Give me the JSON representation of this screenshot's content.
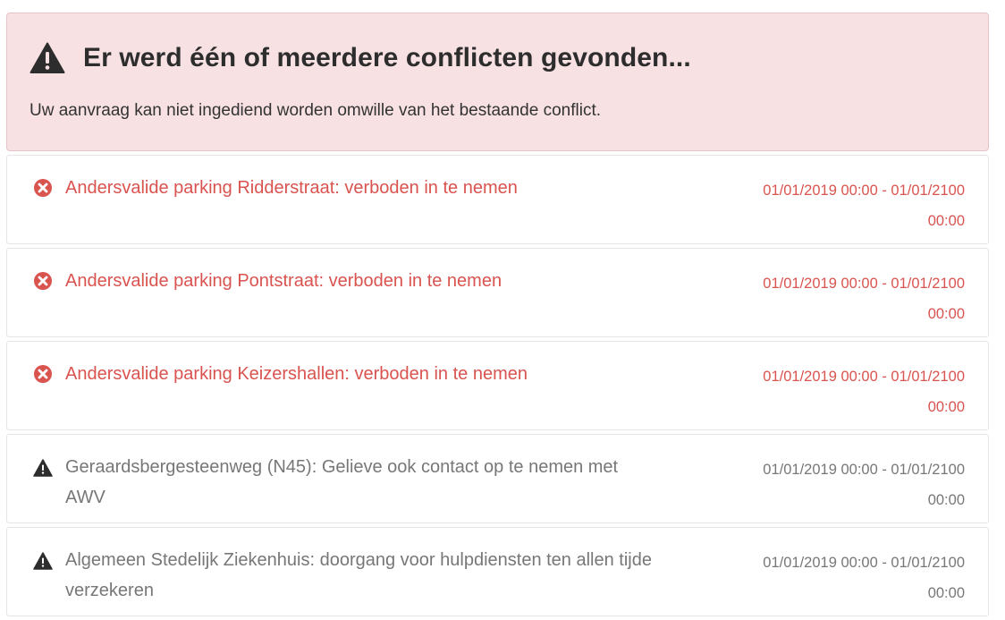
{
  "alert": {
    "title": "Er werd één of meerdere conflicten gevonden...",
    "message": "Uw aanvraag kan niet ingediend worden omwille van het bestaande conflict.",
    "icon": "warning-triangle-icon",
    "background": "#f8e1e3"
  },
  "conflicts": [
    {
      "type": "error",
      "icon": "error-circle-icon",
      "description": "Andersvalide parking Ridderstraat: verboden in te nemen",
      "period_start": "01/01/2019 00:00 - 01/01/2100",
      "period_end": "00:00"
    },
    {
      "type": "error",
      "icon": "error-circle-icon",
      "description": "Andersvalide parking Pontstraat: verboden in te nemen",
      "period_start": "01/01/2019 00:00 - 01/01/2100",
      "period_end": "00:00"
    },
    {
      "type": "error",
      "icon": "error-circle-icon",
      "description": "Andersvalide parking Keizershallen: verboden in te nemen",
      "period_start": "01/01/2019 00:00 - 01/01/2100",
      "period_end": "00:00"
    },
    {
      "type": "warning",
      "icon": "warning-triangle-icon",
      "description": "Geraardsbergesteenweg (N45): Gelieve ook contact op te nemen met AWV",
      "period_start": "01/01/2019 00:00 - 01/01/2100",
      "period_end": "00:00"
    },
    {
      "type": "warning",
      "icon": "warning-triangle-icon",
      "description": "Algemeen Stedelijk Ziekenhuis: doorgang voor hulpdiensten ten allen tijde verzekeren",
      "period_start": "01/01/2019 00:00 - 01/01/2100",
      "period_end": "00:00"
    }
  ],
  "colors": {
    "error": "#d9534f",
    "warning": "#777777",
    "title": "#2d2d2d"
  }
}
